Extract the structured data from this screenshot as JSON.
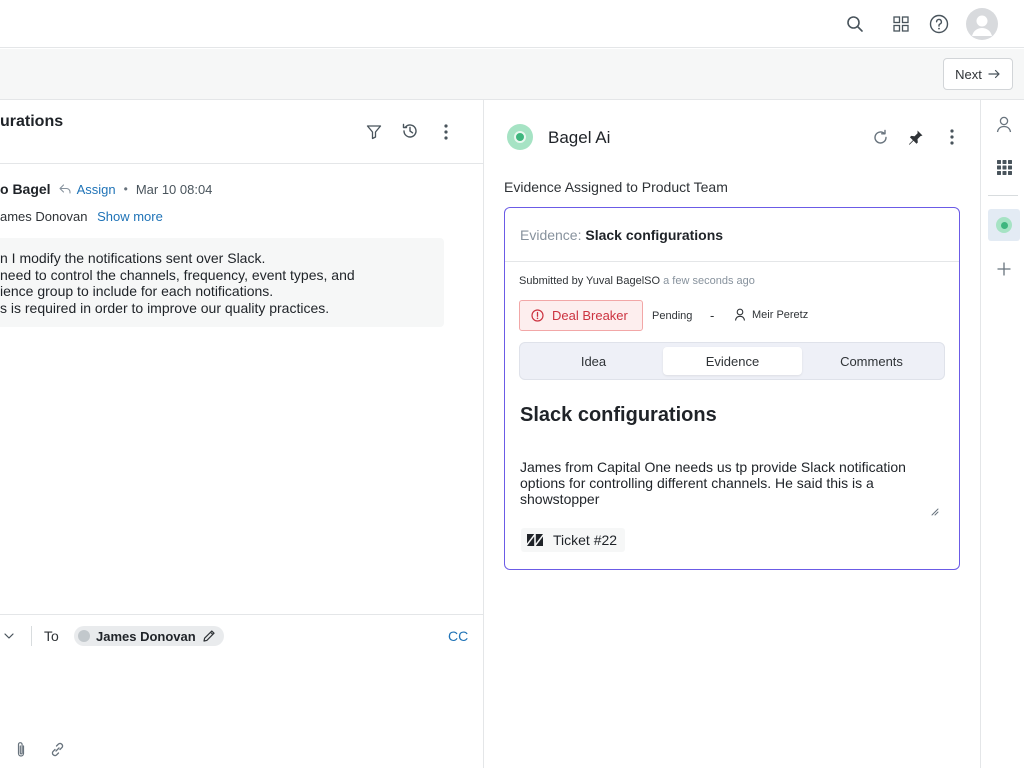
{
  "topbar": {
    "icons": [
      "search-icon",
      "apps-grid-icon",
      "help-icon",
      "user-avatar-icon"
    ]
  },
  "subbar": {
    "next_label": "Next"
  },
  "ticket": {
    "title": "urations",
    "sender_name": "o Bagel",
    "assign_label": "Assign",
    "date": "Mar 10 08:04",
    "to_text": "ames Donovan",
    "show_more": "Show more",
    "message_lines": [
      "n I modify the notifications sent over Slack.",
      " need to control the channels, frequency, event types, and",
      "ience group to include for each notifications.",
      "s is required in order to improve our quality practices."
    ]
  },
  "reply": {
    "to_label": "To",
    "recipient": "James Donovan",
    "cc_label": "CC"
  },
  "app": {
    "title": "Bagel Ai",
    "section_label": "Evidence Assigned to Product Team",
    "card": {
      "header_label": "Evidence:",
      "header_value": "Slack configurations",
      "submitted_prefix": "Submitted by Yuval BagelSO",
      "submitted_when": "a few seconds ago",
      "priority": "Deal Breaker",
      "status": "Pending",
      "dash": "-",
      "owner": "Meir Peretz",
      "tabs": [
        "Idea",
        "Evidence",
        "Comments"
      ],
      "active_tab": "Evidence",
      "title": "Slack configurations",
      "body": "James from Capital One needs us tp provide Slack notification options for controlling different channels. He said this is a showstopper",
      "ticket_label": "Ticket #22"
    },
    "accent_color": "#6b5be6",
    "priority_color": "#cc3340"
  }
}
